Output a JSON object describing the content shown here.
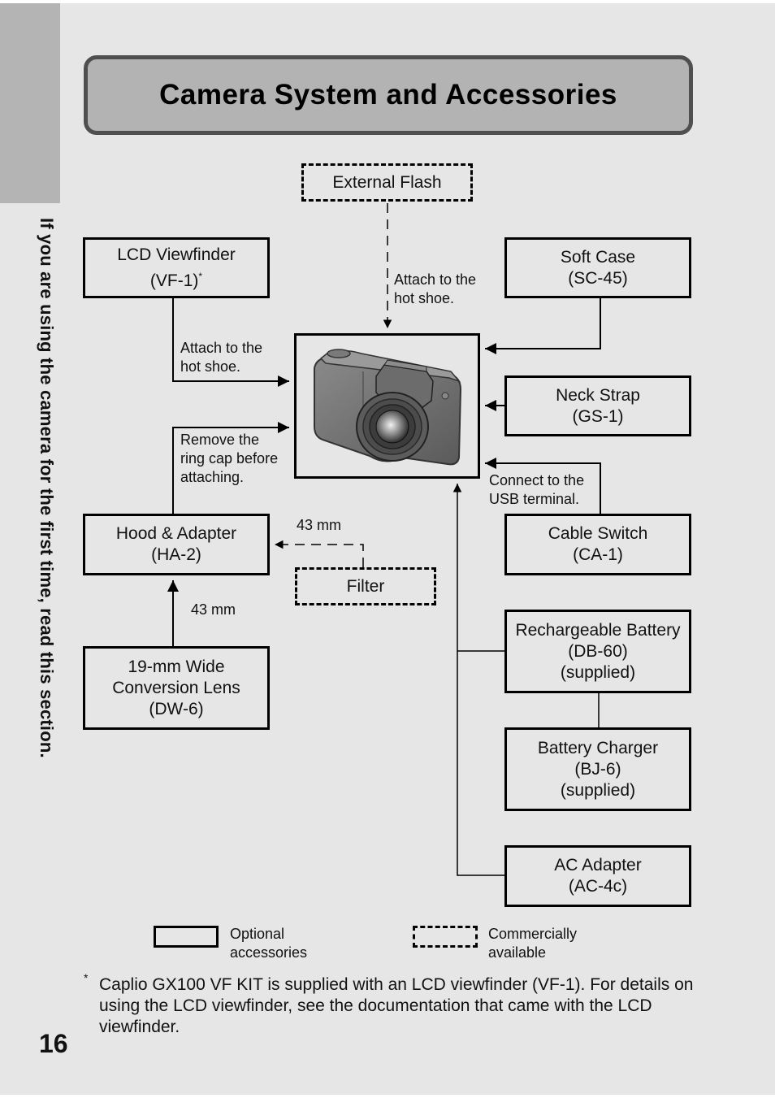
{
  "page": {
    "title": "Camera System and Accessories",
    "side_text": "If you are using the camera for the first time, read this section.",
    "page_number": "16",
    "colors": {
      "background": "#e6e6e6",
      "side_tab": "#b4b4b4",
      "title_fill": "#b3b3b3",
      "title_border": "#4f4f4f"
    }
  },
  "diagram": {
    "center": {
      "name": "Camera (Caplio GX100)",
      "icon": "camera-image"
    },
    "external_flash": {
      "line1": "External Flash",
      "type": "commercially-available"
    },
    "flash_note": {
      "line1": "Attach to the",
      "line2": "hot shoe."
    },
    "lcd_viewfinder": {
      "line1": "LCD Viewfinder",
      "line2": "(VF-1)",
      "marker": "*",
      "type": "optional"
    },
    "viewfinder_note": {
      "line1": "Attach to the",
      "line2": "hot shoe."
    },
    "ring_cap_note": {
      "line1": "Remove the",
      "line2": "ring cap before",
      "line3": "attaching."
    },
    "hood_adapter": {
      "line1": "Hood & Adapter",
      "line2": "(HA-2)",
      "type": "optional"
    },
    "filter_size": "43 mm",
    "filter": {
      "line1": "Filter",
      "type": "commercially-available"
    },
    "lens_size": "43 mm",
    "wide_lens": {
      "line1": "19-mm Wide",
      "line2": "Conversion Lens",
      "line3": "(DW-6)",
      "type": "optional"
    },
    "soft_case": {
      "line1": "Soft Case",
      "line2": "(SC-45)",
      "type": "optional"
    },
    "neck_strap": {
      "line1": "Neck Strap",
      "line2": "(GS-1)",
      "type": "optional"
    },
    "usb_note": {
      "line1": "Connect to the",
      "line2": "USB terminal."
    },
    "cable_switch": {
      "line1": "Cable Switch",
      "line2": "(CA-1)",
      "type": "optional"
    },
    "battery": {
      "line1": "Rechargeable Battery",
      "line2": "(DB-60)",
      "line3": "(supplied)",
      "type": "optional"
    },
    "charger": {
      "line1": "Battery Charger",
      "line2": "(BJ-6)",
      "line3": "(supplied)",
      "type": "optional"
    },
    "ac_adapter": {
      "line1": "AC Adapter",
      "line2": "(AC-4c)",
      "type": "optional"
    }
  },
  "legend": {
    "solid": {
      "line1": "Optional",
      "line2": "accessories"
    },
    "dashed": {
      "line1": "Commercially",
      "line2": "available"
    }
  },
  "footnote": {
    "marker": "*",
    "text": "Caplio GX100 VF KIT is supplied with an LCD viewfinder (VF-1). For details on using the LCD viewfinder, see the documentation that came with the LCD viewfinder."
  }
}
